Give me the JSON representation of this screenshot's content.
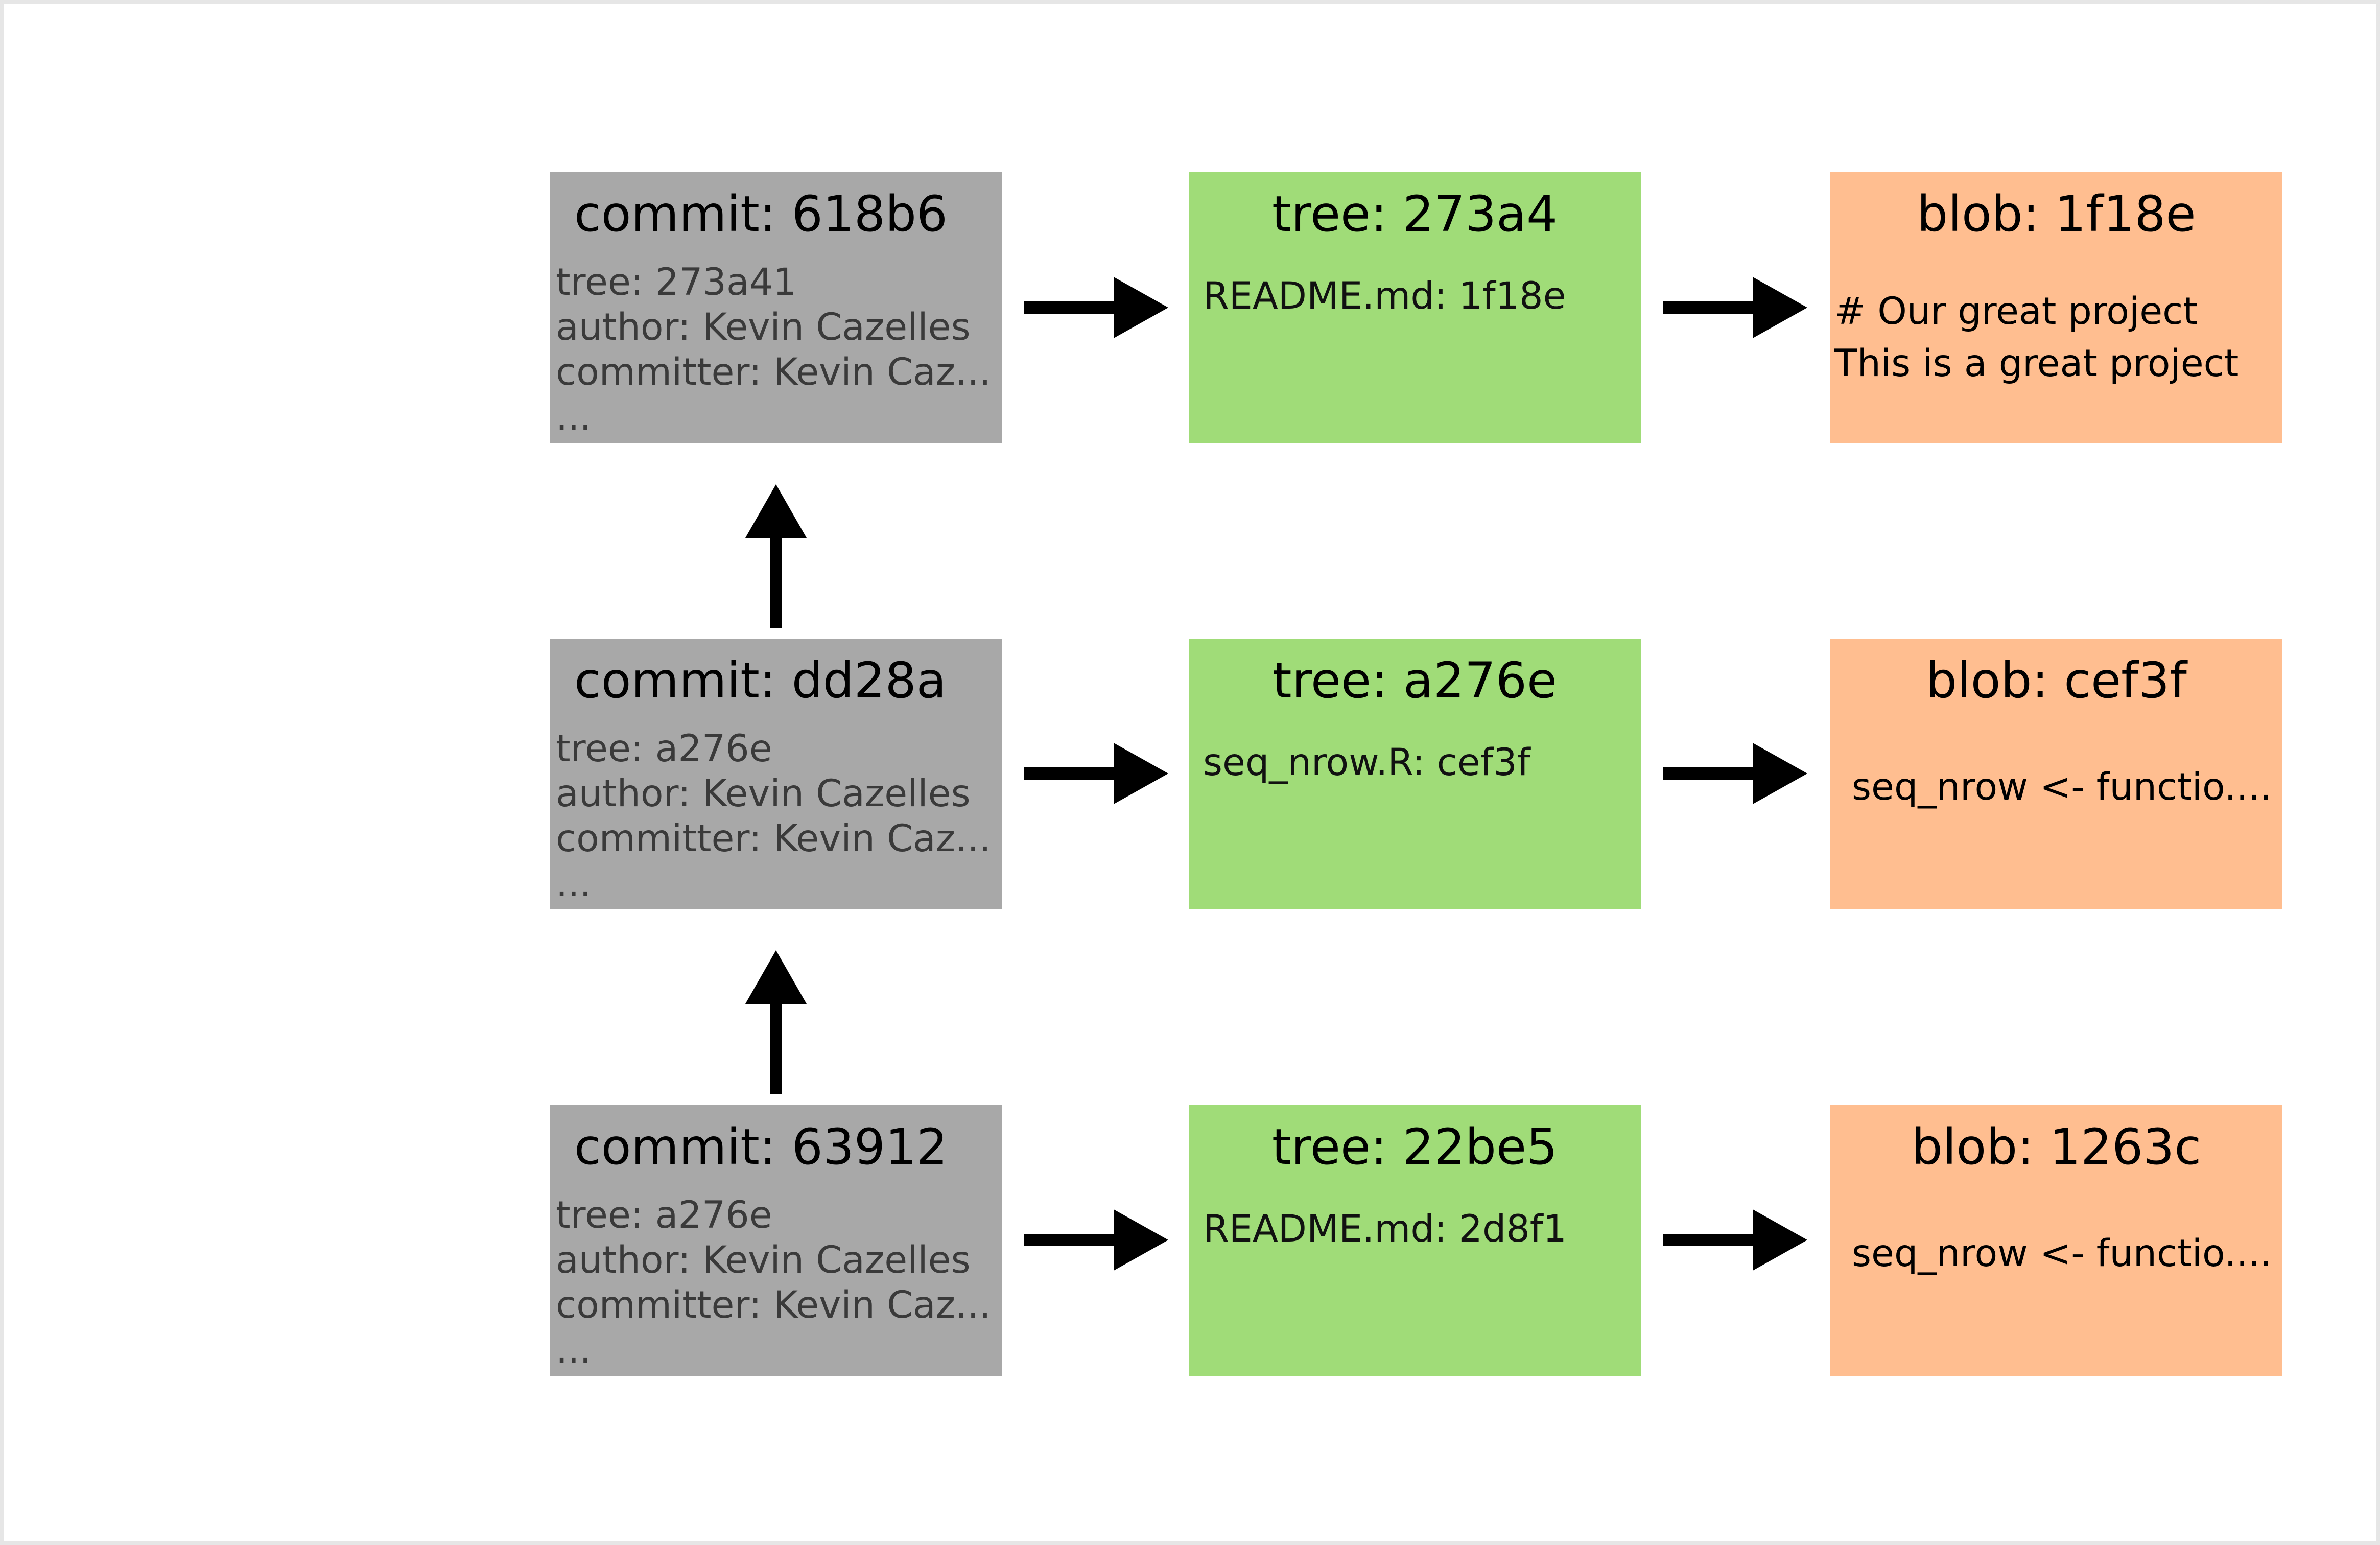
{
  "commits": [
    {
      "title": "commit: 618b6",
      "lines": [
        "tree: 273a41",
        "author: Kevin Cazelles",
        "committer: Kevin Caz...",
        "..."
      ]
    },
    {
      "title": "commit: dd28a",
      "lines": [
        "tree: a276e",
        "author: Kevin Cazelles",
        "committer: Kevin Caz...",
        "..."
      ]
    },
    {
      "title": "commit: 63912",
      "lines": [
        "tree: a276e",
        "author: Kevin Cazelles",
        "committer: Kevin Caz...",
        "..."
      ]
    }
  ],
  "trees": [
    {
      "title": "tree: 273a4",
      "entry": "README.md: 1f18e"
    },
    {
      "title": "tree: a276e",
      "entry": "seq_nrow.R: cef3f"
    },
    {
      "title": "tree: 22be5",
      "entry": "README.md: 2d8f1"
    }
  ],
  "blobs": [
    {
      "title": "blob: 1f18e",
      "lines": [
        "# Our great project",
        "This is a great project"
      ]
    },
    {
      "title": "blob: cef3f",
      "lines": [
        "seq_nrow <- functio...."
      ]
    },
    {
      "title": "blob: 1263c",
      "lines": [
        "seq_nrow <- functio...."
      ]
    }
  ],
  "colors": {
    "commit": "#a8a8a8",
    "tree": "#a0dc78",
    "blob": "#ffbe90",
    "arrow": "#000000"
  }
}
